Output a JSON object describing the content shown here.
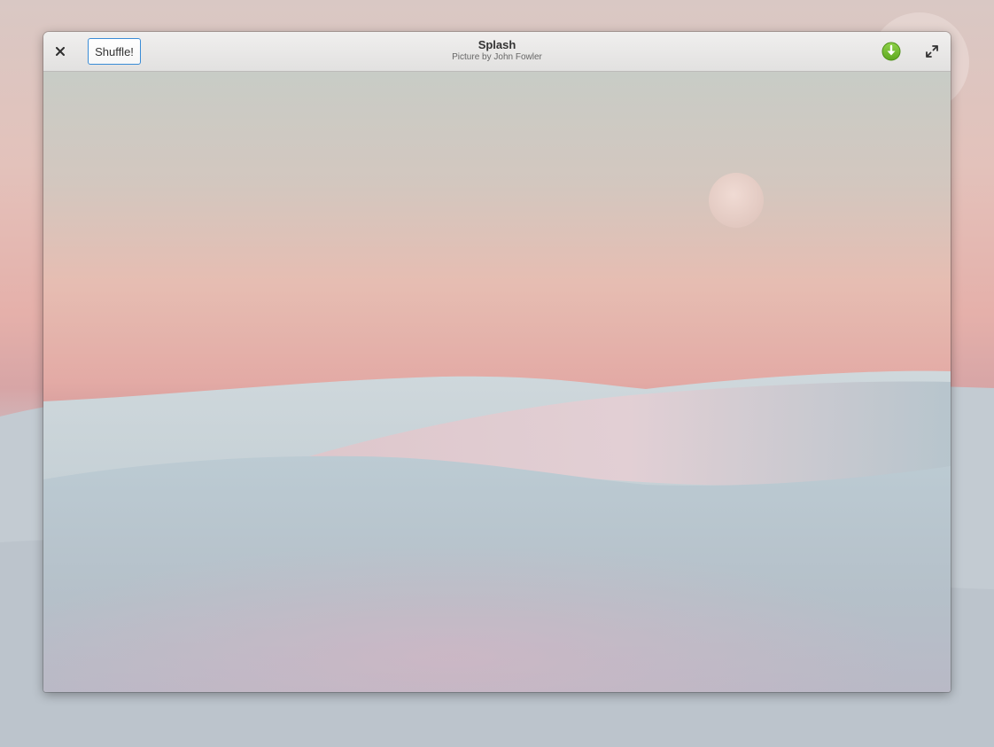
{
  "window": {
    "title": "Splash",
    "subtitle": "Picture by John Fowler"
  },
  "headerbar": {
    "close_icon": "close-icon",
    "shuffle_label": "Shuffle!",
    "download_icon": "download-icon",
    "fullscreen_icon": "fullscreen-icon"
  },
  "colors": {
    "accent_border": "#3a8cd6",
    "download_green": "#73c12e",
    "sky_top": "#c9cdc8",
    "sky_pink": "#e7b2ab",
    "dune_blue": "#b7c6cf"
  }
}
